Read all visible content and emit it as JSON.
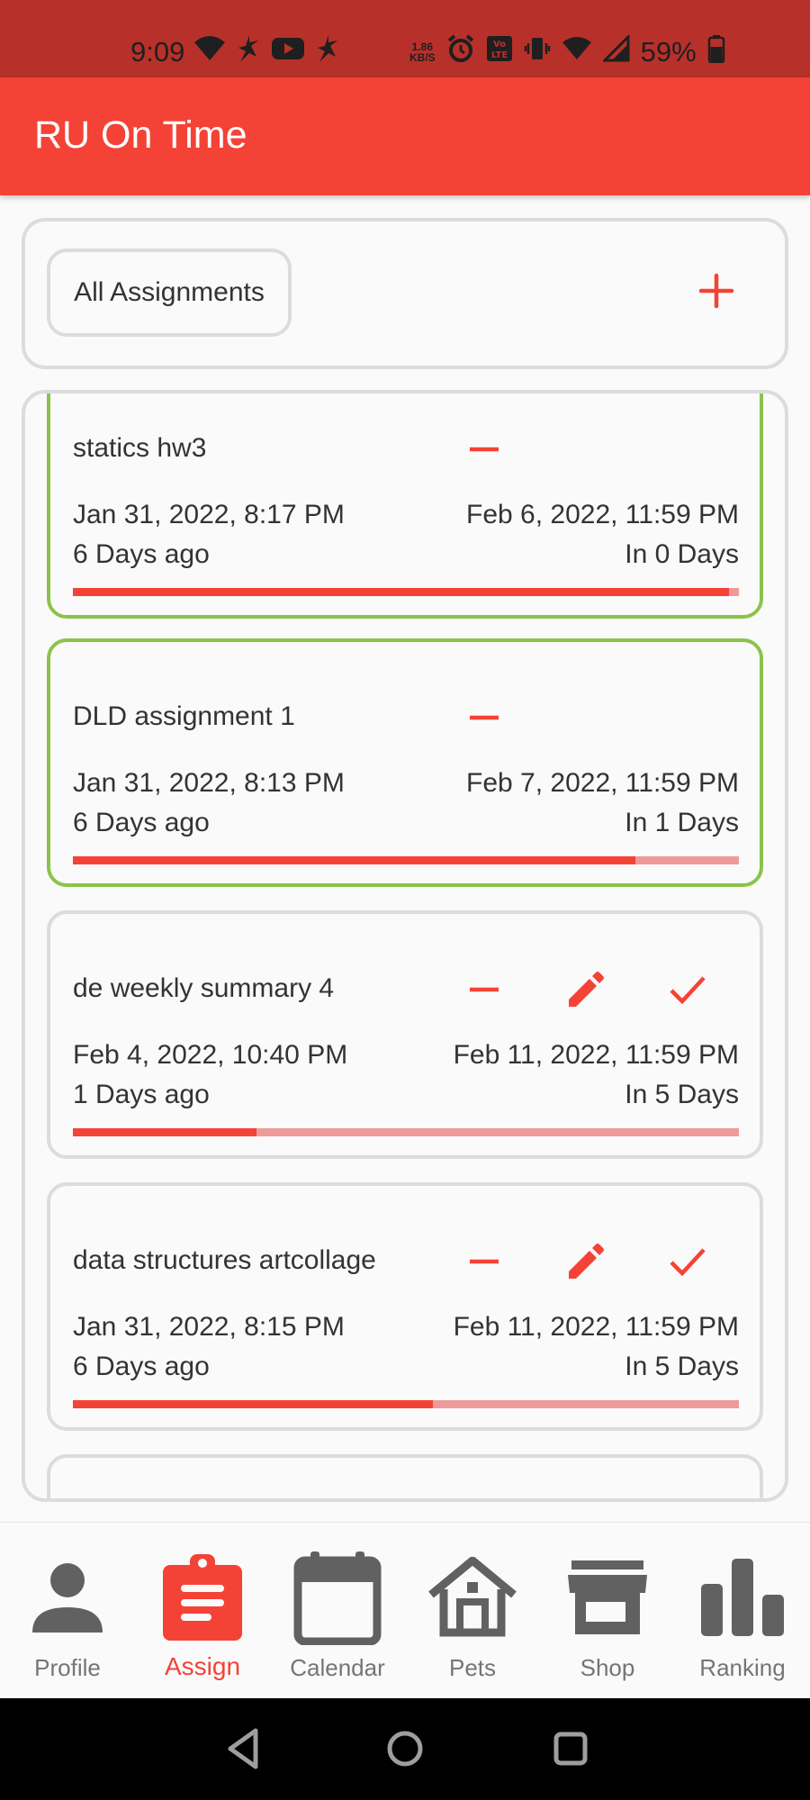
{
  "status_bar": {
    "time": "9:09",
    "speed_top": "1.86",
    "speed_bottom": "KB/S",
    "volte": "Vo LTE",
    "battery": "59%"
  },
  "app_bar": {
    "title": "RU On Time"
  },
  "filter": {
    "label": "All Assignments"
  },
  "assignments": [
    {
      "name": "statics hw3",
      "assigned": "Jan 31, 2022, 8:17 PM",
      "due": "Feb 6, 2022, 11:59 PM",
      "ago": "6 Days ago",
      "remaining": "In 0 Days",
      "progress": 0.985,
      "highlighted": true,
      "show_edit": false,
      "show_done": false
    },
    {
      "name": "DLD assignment 1",
      "assigned": "Jan 31, 2022, 8:13 PM",
      "due": "Feb 7, 2022, 11:59 PM",
      "ago": "6 Days ago",
      "remaining": "In 1 Days",
      "progress": 0.845,
      "highlighted": true,
      "show_edit": false,
      "show_done": false
    },
    {
      "name": "de weekly summary 4",
      "assigned": "Feb 4, 2022, 10:40 PM",
      "due": "Feb 11, 2022, 11:59 PM",
      "ago": "1 Days ago",
      "remaining": "In 5 Days",
      "progress": 0.275,
      "highlighted": false,
      "show_edit": true,
      "show_done": true
    },
    {
      "name": "data structures artcollage",
      "assigned": "Jan 31, 2022, 8:15 PM",
      "due": "Feb 11, 2022, 11:59 PM",
      "ago": "6 Days ago",
      "remaining": "In 5 Days",
      "progress": 0.54,
      "highlighted": false,
      "show_edit": true,
      "show_done": true
    }
  ],
  "bottom_nav": [
    {
      "label": "Profile",
      "icon": "person-icon",
      "active": false
    },
    {
      "label": "Assign",
      "icon": "assignment-icon",
      "active": true
    },
    {
      "label": "Calendar",
      "icon": "calendar-icon",
      "active": false
    },
    {
      "label": "Pets",
      "icon": "house-icon",
      "active": false
    },
    {
      "label": "Shop",
      "icon": "store-icon",
      "active": false
    },
    {
      "label": "Ranking",
      "icon": "bar-chart-icon",
      "active": false
    }
  ],
  "colors": {
    "accent": "#f44336",
    "status_bar": "#b8302a",
    "highlight_border": "#8bc34a",
    "progress_track": "#ef9a9a",
    "nav_inactive": "#616161"
  }
}
